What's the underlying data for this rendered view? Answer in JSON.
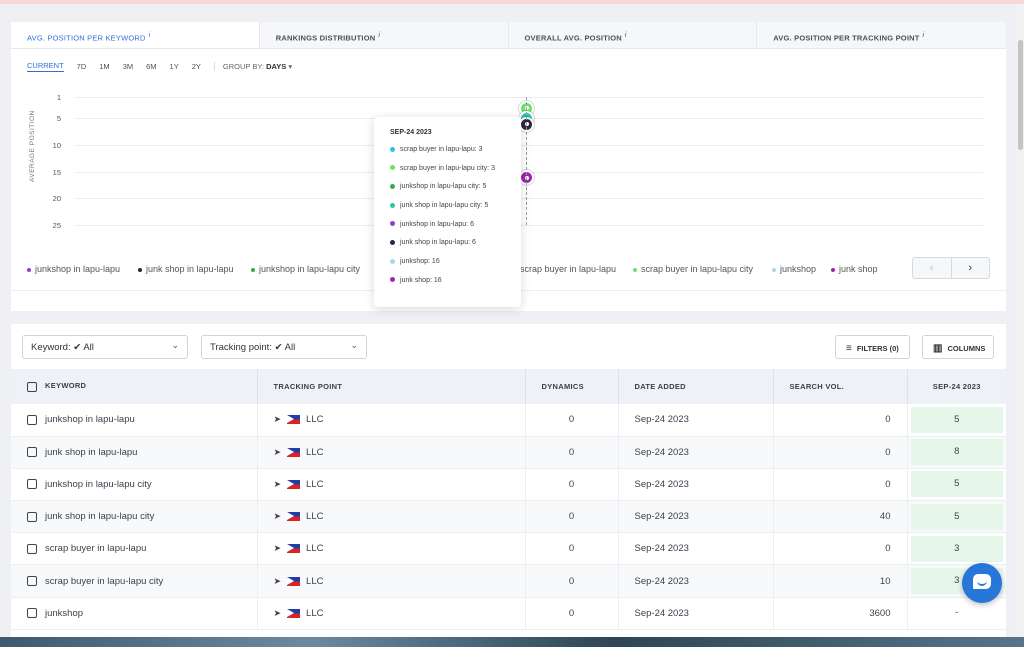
{
  "tabs": [
    {
      "label": "AVG. POSITION PER KEYWORD",
      "info": "i"
    },
    {
      "label": "RANKINGS DISTRIBUTION",
      "info": "i"
    },
    {
      "label": "OVERALL AVG. POSITION",
      "info": "i"
    },
    {
      "label": "AVG. POSITION PER TRACKING POINT",
      "info": "i"
    }
  ],
  "periods": [
    "CURRENT",
    "7D",
    "1M",
    "3M",
    "6M",
    "1Y",
    "2Y"
  ],
  "group_by": {
    "label": "GROUP BY:",
    "value": "DAYS"
  },
  "chart_data": {
    "type": "scatter",
    "ylabel": "AVERAGE POSITION",
    "ylim": [
      1,
      25
    ],
    "y_inverted": true,
    "yticks": [
      "1",
      "5",
      "10",
      "15",
      "20",
      "25"
    ],
    "x": [
      "Sep-24 2023"
    ],
    "series": [
      {
        "name": "scrap buyer in lapu-lapu",
        "values": [
          3
        ],
        "color": "#2bc4e6"
      },
      {
        "name": "scrap buyer in lapu-lapu city",
        "values": [
          3
        ],
        "color": "#6fe06a"
      },
      {
        "name": "junkshop in lapu-lapu city",
        "values": [
          5
        ],
        "color": "#3aa84a"
      },
      {
        "name": "junk shop in lapu-lapu city",
        "values": [
          5
        ],
        "color": "#22c9a5"
      },
      {
        "name": "junkshop in lapu-lapu",
        "values": [
          6
        ],
        "color": "#8f3fd0"
      },
      {
        "name": "junk shop in lapu-lapu",
        "values": [
          6
        ],
        "color": "#2e2540"
      },
      {
        "name": "junkshop",
        "values": [
          16
        ],
        "color": "#a9d8ea"
      },
      {
        "name": "junk shop",
        "values": [
          16
        ],
        "color": "#a023b0"
      }
    ]
  },
  "tooltip": {
    "title": "SEP-24 2023",
    "rows": [
      {
        "label": "scrap buyer in lapu-lapu:",
        "value": "3",
        "color": "#2bc4e6"
      },
      {
        "label": "scrap buyer in lapu-lapu city:",
        "value": "3",
        "color": "#6fe06a"
      },
      {
        "label": "junkshop in lapu-lapu city:",
        "value": "5",
        "color": "#3aa84a"
      },
      {
        "label": "junk shop in lapu-lapu city:",
        "value": "5",
        "color": "#22c9a5"
      },
      {
        "label": "junkshop in lapu-lapu:",
        "value": "6",
        "color": "#8f3fd0"
      },
      {
        "label": "junk shop in lapu-lapu:",
        "value": "6",
        "color": "#2e2540"
      },
      {
        "label": "junkshop:",
        "value": "16",
        "color": "#a9d8ea"
      },
      {
        "label": "junk shop:",
        "value": "16",
        "color": "#a023b0"
      }
    ]
  },
  "legend": [
    {
      "label": "junkshop in lapu-lapu",
      "color": "#8f3fd0"
    },
    {
      "label": "junk shop in lapu-lapu",
      "color": "#2e2540"
    },
    {
      "label": "junkshop in lapu-lapu city",
      "color": "#3aa84a"
    },
    {
      "label": "scrap buyer in lapu-lapu",
      "color": "#2bc4e6"
    },
    {
      "label": "scrap buyer in lapu-lapu city",
      "color": "#6fe06a"
    },
    {
      "label": "junkshop",
      "color": "#a9d8ea"
    },
    {
      "label": "junk shop",
      "color": "#a023b0"
    }
  ],
  "legend_nav": {
    "prev": "‹",
    "next": "›"
  },
  "filters": {
    "keyword_label": "Keyword:",
    "keyword_value": "✔ All",
    "tracking_label": "Tracking point:",
    "tracking_value": "✔ All",
    "filters_button": "FILTERS (0)",
    "columns_button": "COLUMNS"
  },
  "table": {
    "headers": [
      "KEYWORD",
      "TRACKING POINT",
      "DYNAMICS",
      "DATE ADDED",
      "SEARCH VOL.",
      "SEP-24 2023"
    ],
    "rows": [
      {
        "keyword": "junkshop in lapu-lapu",
        "tracking": "LLC",
        "dynamics": "0",
        "date": "Sep-24 2023",
        "volume": "0",
        "rank": "5"
      },
      {
        "keyword": "junk shop in lapu-lapu",
        "tracking": "LLC",
        "dynamics": "0",
        "date": "Sep-24 2023",
        "volume": "0",
        "rank": "8"
      },
      {
        "keyword": "junkshop in lapu-lapu city",
        "tracking": "LLC",
        "dynamics": "0",
        "date": "Sep-24 2023",
        "volume": "0",
        "rank": "5"
      },
      {
        "keyword": "junk shop in lapu-lapu city",
        "tracking": "LLC",
        "dynamics": "0",
        "date": "Sep-24 2023",
        "volume": "40",
        "rank": "5"
      },
      {
        "keyword": "scrap buyer in lapu-lapu",
        "tracking": "LLC",
        "dynamics": "0",
        "date": "Sep-24 2023",
        "volume": "0",
        "rank": "3"
      },
      {
        "keyword": "scrap buyer in lapu-lapu city",
        "tracking": "LLC",
        "dynamics": "0",
        "date": "Sep-24 2023",
        "volume": "10",
        "rank": "3"
      },
      {
        "keyword": "junkshop",
        "tracking": "LLC",
        "dynamics": "0",
        "date": "Sep-24 2023",
        "volume": "3600",
        "rank": "-"
      }
    ]
  },
  "icons": {
    "chevron": "⌄",
    "collapse": "^",
    "filter": "≡",
    "columns": "▥",
    "navigate": "➤"
  }
}
